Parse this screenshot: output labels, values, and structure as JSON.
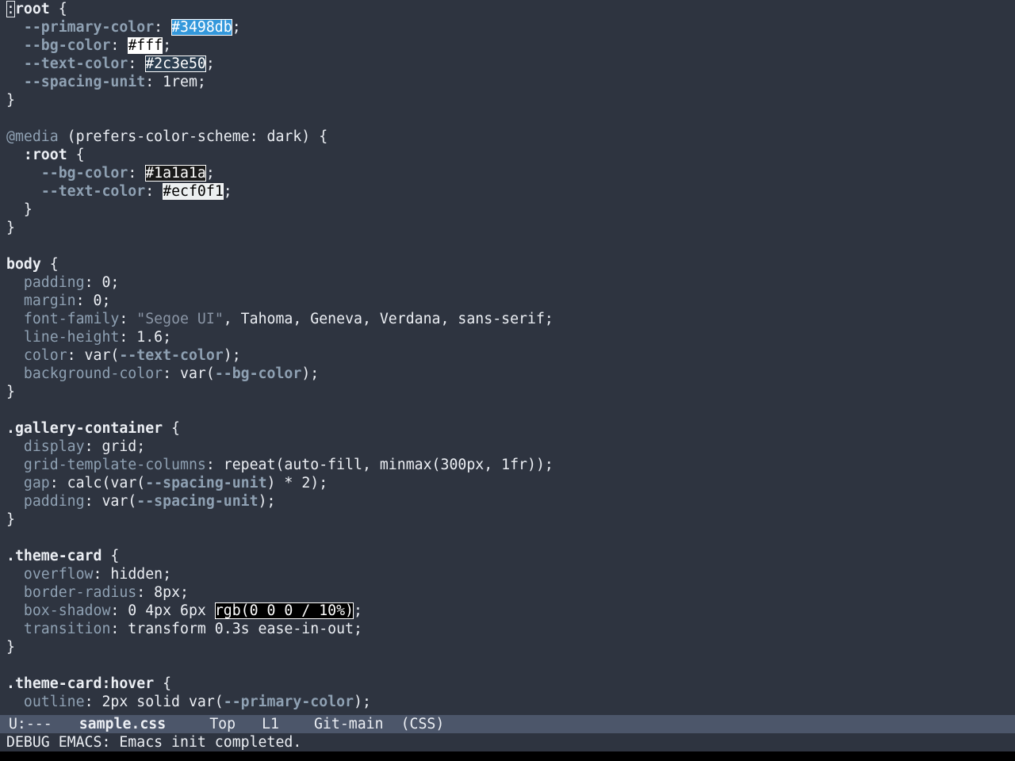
{
  "editor": {
    "lines": [
      [
        {
          "t": ":",
          "c": "cursor"
        },
        {
          "t": "root",
          "c": "sel"
        },
        {
          "t": " {"
        }
      ],
      [
        {
          "t": "  "
        },
        {
          "t": "--primary-color",
          "c": "var"
        },
        {
          "t": ": "
        },
        {
          "t": "#3498db",
          "sw": "#3498db",
          "fg": "#ffffff"
        },
        {
          "t": ";"
        }
      ],
      [
        {
          "t": "  "
        },
        {
          "t": "--bg-color",
          "c": "var"
        },
        {
          "t": ": "
        },
        {
          "t": "#fff",
          "sw": "#ffffff",
          "fg": "#000000"
        },
        {
          "t": ";"
        }
      ],
      [
        {
          "t": "  "
        },
        {
          "t": "--text-color",
          "c": "var"
        },
        {
          "t": ": "
        },
        {
          "t": "#2c3e50",
          "sw": "#2c3e50",
          "fg": "#ffffff"
        },
        {
          "t": ";"
        }
      ],
      [
        {
          "t": "  "
        },
        {
          "t": "--spacing-unit",
          "c": "var"
        },
        {
          "t": ": 1rem;"
        }
      ],
      [
        {
          "t": "}"
        }
      ],
      [
        {
          "t": ""
        }
      ],
      [
        {
          "t": "@media",
          "c": "at"
        },
        {
          "t": " (prefers-color-scheme: dark) {"
        }
      ],
      [
        {
          "t": "  "
        },
        {
          "t": ":root",
          "c": "sel"
        },
        {
          "t": " {"
        }
      ],
      [
        {
          "t": "    "
        },
        {
          "t": "--bg-color",
          "c": "var"
        },
        {
          "t": ": "
        },
        {
          "t": "#1a1a1a",
          "sw": "#1a1a1a",
          "fg": "#ffffff"
        },
        {
          "t": ";"
        }
      ],
      [
        {
          "t": "    "
        },
        {
          "t": "--text-color",
          "c": "var"
        },
        {
          "t": ": "
        },
        {
          "t": "#ecf0f1",
          "sw": "#ecf0f1",
          "fg": "#000000"
        },
        {
          "t": ";"
        }
      ],
      [
        {
          "t": "  }"
        }
      ],
      [
        {
          "t": "}"
        }
      ],
      [
        {
          "t": ""
        }
      ],
      [
        {
          "t": "body",
          "c": "sel"
        },
        {
          "t": " {"
        }
      ],
      [
        {
          "t": "  "
        },
        {
          "t": "padding",
          "c": "attr"
        },
        {
          "t": ": 0;"
        }
      ],
      [
        {
          "t": "  "
        },
        {
          "t": "margin",
          "c": "attr"
        },
        {
          "t": ": 0;"
        }
      ],
      [
        {
          "t": "  "
        },
        {
          "t": "font-family",
          "c": "attr"
        },
        {
          "t": ": "
        },
        {
          "t": "\"Segoe UI\"",
          "c": "str"
        },
        {
          "t": ", Tahoma, Geneva, Verdana, sans-serif;"
        }
      ],
      [
        {
          "t": "  "
        },
        {
          "t": "line-height",
          "c": "attr"
        },
        {
          "t": ": 1.6;"
        }
      ],
      [
        {
          "t": "  "
        },
        {
          "t": "color",
          "c": "attr"
        },
        {
          "t": ": var("
        },
        {
          "t": "--text-color",
          "c": "var"
        },
        {
          "t": ");"
        }
      ],
      [
        {
          "t": "  "
        },
        {
          "t": "background-color",
          "c": "attr"
        },
        {
          "t": ": var("
        },
        {
          "t": "--bg-color",
          "c": "var"
        },
        {
          "t": ");"
        }
      ],
      [
        {
          "t": "}"
        }
      ],
      [
        {
          "t": ""
        }
      ],
      [
        {
          "t": ".gallery-container",
          "c": "sel"
        },
        {
          "t": " {"
        }
      ],
      [
        {
          "t": "  "
        },
        {
          "t": "display",
          "c": "attr"
        },
        {
          "t": ": grid;"
        }
      ],
      [
        {
          "t": "  "
        },
        {
          "t": "grid-template-columns",
          "c": "attr"
        },
        {
          "t": ": repeat(auto-fill, minmax(300px, 1fr));"
        }
      ],
      [
        {
          "t": "  "
        },
        {
          "t": "gap",
          "c": "attr"
        },
        {
          "t": ": calc(var("
        },
        {
          "t": "--spacing-unit",
          "c": "var"
        },
        {
          "t": ") * 2);"
        }
      ],
      [
        {
          "t": "  "
        },
        {
          "t": "padding",
          "c": "attr"
        },
        {
          "t": ": var("
        },
        {
          "t": "--spacing-unit",
          "c": "var"
        },
        {
          "t": ");"
        }
      ],
      [
        {
          "t": "}"
        }
      ],
      [
        {
          "t": ""
        }
      ],
      [
        {
          "t": ".theme-card",
          "c": "sel"
        },
        {
          "t": " {"
        }
      ],
      [
        {
          "t": "  "
        },
        {
          "t": "overflow",
          "c": "attr"
        },
        {
          "t": ": hidden;"
        }
      ],
      [
        {
          "t": "  "
        },
        {
          "t": "border-radius",
          "c": "attr"
        },
        {
          "t": ": 8px;"
        }
      ],
      [
        {
          "t": "  "
        },
        {
          "t": "box-shadow",
          "c": "attr"
        },
        {
          "t": ": 0 4px 6px "
        },
        {
          "t": "rgb(0 0 0 / 10%)",
          "sw": "#000000",
          "fg": "#ffffff"
        },
        {
          "t": ";"
        }
      ],
      [
        {
          "t": "  "
        },
        {
          "t": "transition",
          "c": "attr"
        },
        {
          "t": ": transform 0.3s ease-in-out;"
        }
      ],
      [
        {
          "t": "}"
        }
      ],
      [
        {
          "t": ""
        }
      ],
      [
        {
          "t": ".theme-card:hover",
          "c": "sel"
        },
        {
          "t": " {"
        }
      ],
      [
        {
          "t": "  "
        },
        {
          "t": "outline",
          "c": "attr"
        },
        {
          "t": ": 2px solid var("
        },
        {
          "t": "--primary-color",
          "c": "var"
        },
        {
          "t": ");"
        }
      ]
    ]
  },
  "modeline": {
    "status": " U:---",
    "buffer": "sample.css",
    "position": "Top",
    "line": "L1",
    "vc": "Git-main",
    "mode": "(CSS)"
  },
  "echo": {
    "message": "DEBUG EMACS: Emacs init completed."
  },
  "colors": {
    "background": "#2e3440",
    "modeline_bg": "#4c566a",
    "text": "#eceff4",
    "keyword": "#8fa1b3"
  }
}
